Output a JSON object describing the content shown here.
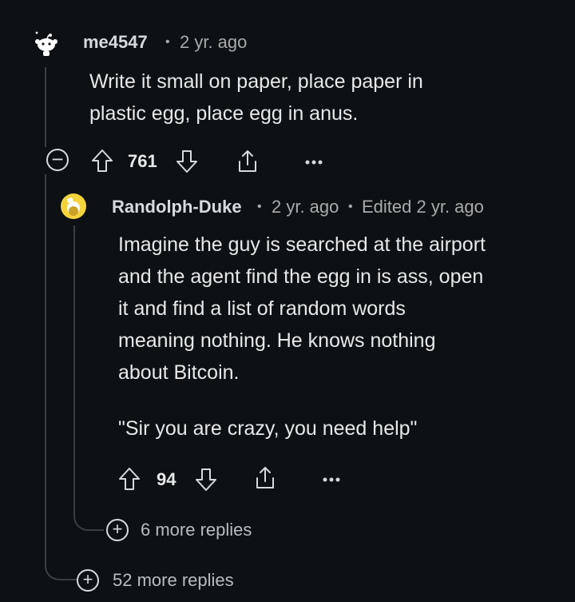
{
  "comment1": {
    "username": "me4547",
    "time": "2 yr. ago",
    "body": [
      "Write it small on paper, place paper in",
      "plastic egg, place egg in anus."
    ],
    "votes": "761",
    "collapse_icon": "minus-circle-icon",
    "more_icon": "ellipsis-icon"
  },
  "comment2": {
    "username": "Randolph-Duke",
    "time": "2 yr. ago",
    "edited": "Edited 2 yr. ago",
    "body": [
      "Imagine the guy is searched at the airport",
      "and the agent find the egg in is ass, open",
      "it and find a list of random words",
      "meaning nothing. He knows nothing",
      "about Bitcoin."
    ],
    "quote": "\"Sir you are crazy, you need help\"",
    "votes": "94",
    "more_icon": "ellipsis-icon"
  },
  "replies_nested": {
    "label": "6 more replies",
    "icon": "plus-circle-icon"
  },
  "replies_top": {
    "label": "52 more replies",
    "icon": "plus-circle-icon"
  },
  "colors": {
    "background": "#0e1113",
    "thread_line": "#3a3f43",
    "text": "#d7dadc",
    "avatar_bg": "#f5d33b"
  }
}
